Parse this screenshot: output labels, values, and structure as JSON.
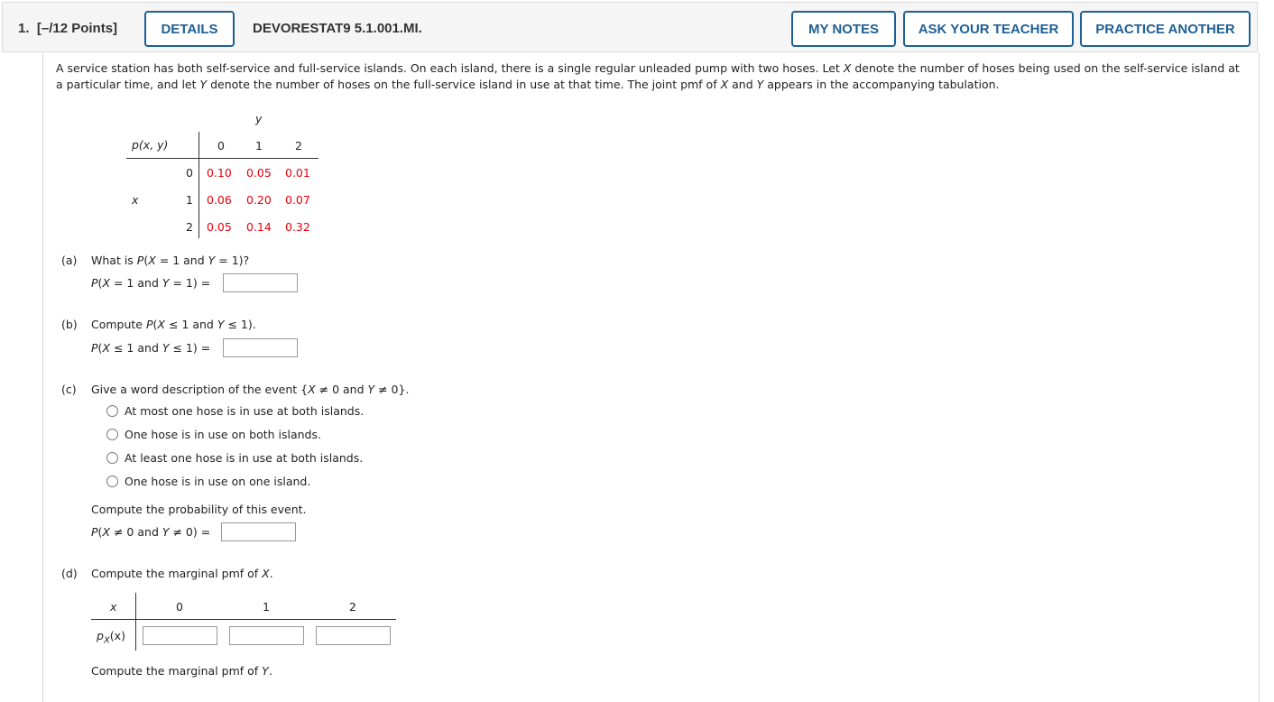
{
  "header": {
    "question_number": "1.",
    "points": "[–/12 Points]",
    "details_label": "DETAILS",
    "question_id": "DEVORESTAT9 5.1.001.MI.",
    "my_notes_label": "MY NOTES",
    "ask_teacher_label": "ASK YOUR TEACHER",
    "practice_another_label": "PRACTICE ANOTHER"
  },
  "intro": {
    "p1": "A service station has both self-service and full-service islands. On each island, there is a single regular unleaded pump with two hoses. Let ",
    "x": "X",
    "p2": " denote the number of hoses being used on the self-service island at a particular time, and let ",
    "y": "Y",
    "p3": " denote the number of hoses on the full-service island in use at that time. The joint pmf of ",
    "x2": "X",
    "p4": " and ",
    "y2": "Y",
    "p5": " appears in the accompanying tabulation."
  },
  "joint_table": {
    "corner_label": "p(x, y)",
    "col_var": "y",
    "row_var": "x",
    "col_headers": [
      "0",
      "1",
      "2"
    ],
    "row_headers": [
      "0",
      "1",
      "2"
    ],
    "cells": [
      [
        "0.10",
        "0.05",
        "0.01"
      ],
      [
        "0.06",
        "0.20",
        "0.07"
      ],
      [
        "0.05",
        "0.14",
        "0.32"
      ]
    ]
  },
  "part_a": {
    "label": "(a)",
    "question": "What is P(X = 1 and Y = 1)?",
    "answer_label": "P(X = 1 and Y = 1) =",
    "answer_value": ""
  },
  "part_b": {
    "label": "(b)",
    "question": "Compute P(X ≤ 1 and Y ≤ 1).",
    "answer_label": "P(X ≤ 1 and Y ≤ 1) =",
    "answer_value": ""
  },
  "part_c": {
    "label": "(c)",
    "question": "Give a word description of the event {X ≠ 0 and Y ≠ 0}.",
    "options": [
      "At most one hose is in use at both islands.",
      "One hose is in use on both islands.",
      "At least one hose is in use at both islands.",
      "One hose is in use on one island."
    ],
    "compute_label": "Compute the probability of this event.",
    "answer_label": "P(X ≠ 0 and Y ≠ 0) =",
    "answer_value": ""
  },
  "part_d": {
    "label": "(d)",
    "question_x": "Compute the marginal pmf of X.",
    "x_header": "x",
    "x_values": [
      "0",
      "1",
      "2"
    ],
    "px_label": "p",
    "px_sub": "X",
    "px_arg": "(x)",
    "question_y": "Compute the marginal pmf of Y."
  }
}
